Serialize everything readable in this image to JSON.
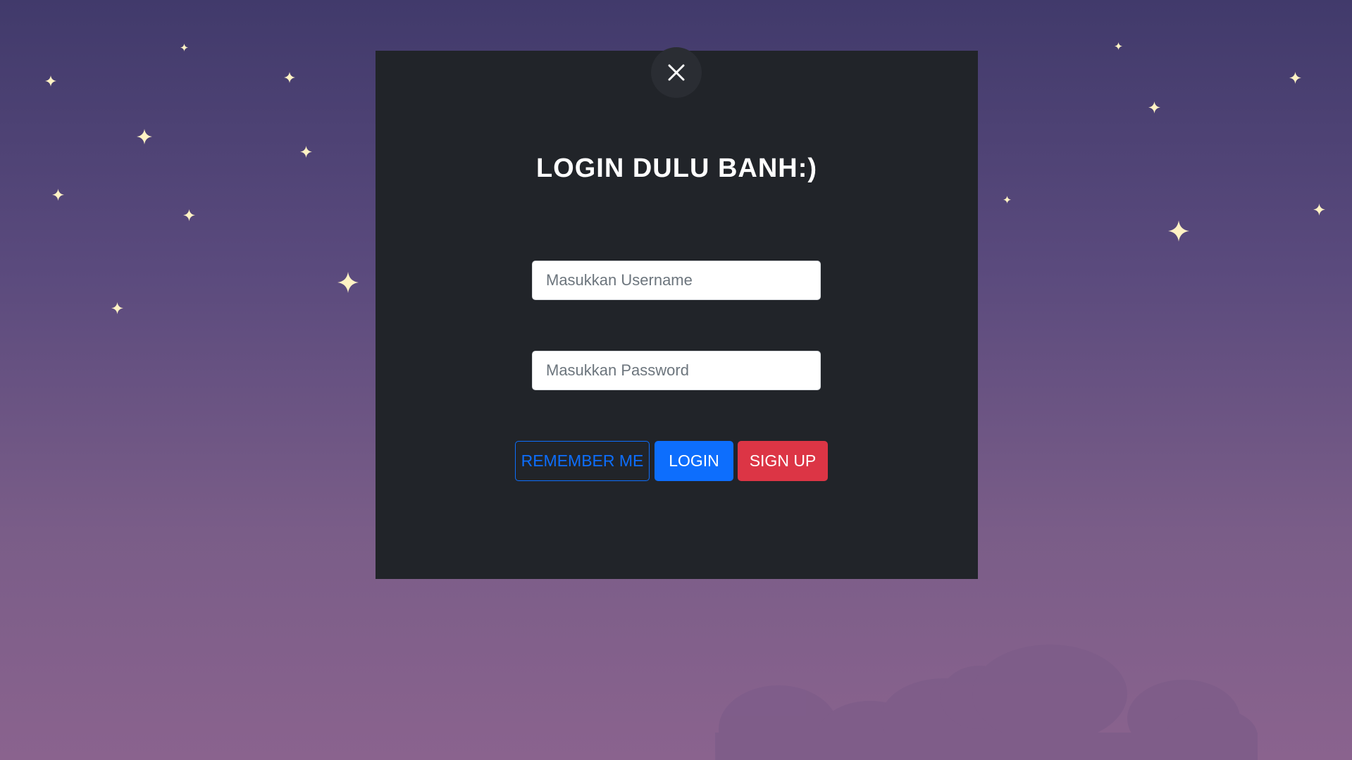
{
  "background": {
    "gradient_top": "#413a6b",
    "gradient_bottom": "#8a638e",
    "star_color": "#fff2c4",
    "cloud_color": "#7e5d89"
  },
  "modal": {
    "background": "#212429",
    "close_icon": "close-icon",
    "title": "LOGIN DULU BANH:)",
    "username": {
      "placeholder": "Masukkan Username",
      "value": ""
    },
    "password": {
      "placeholder": "Masukkan Password",
      "value": ""
    },
    "buttons": {
      "remember_label": "REMEMBER ME",
      "login_label": "LOGIN",
      "signup_label": "SIGN UP"
    },
    "colors": {
      "primary": "#0d6efd",
      "danger": "#dc3545"
    }
  }
}
